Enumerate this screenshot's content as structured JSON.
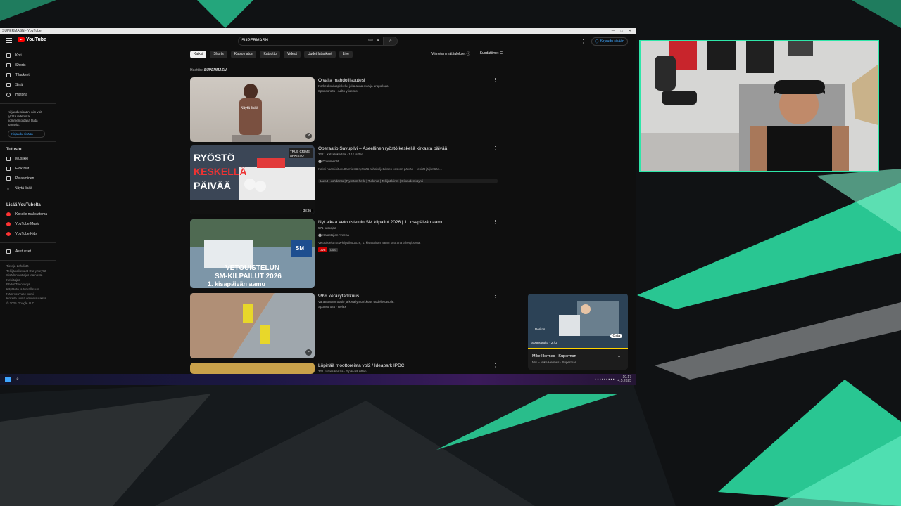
{
  "window": {
    "title": "SUPERMASN - YouTube",
    "controls": [
      "—",
      "□",
      "✕"
    ]
  },
  "header": {
    "logo_text": "YouTube",
    "logo_region": "FI",
    "search_value": "SUPERMASN",
    "search_kbd": "⌨",
    "clear_icon": "close-icon",
    "sign_in_label": "Kirjaudu sisään"
  },
  "sidebar": {
    "items": [
      {
        "label": "Koti",
        "icon": "home-icon"
      },
      {
        "label": "Shorts",
        "icon": "shorts-icon"
      },
      {
        "label": "Tilaukset",
        "icon": "subscriptions-icon"
      },
      {
        "label": "Sinä",
        "icon": "user-icon"
      },
      {
        "label": "Historia",
        "icon": "history-icon"
      }
    ],
    "signin_note": "Kirjaudu sisään, niin voit tykätä videoista, kommentoida ja tilata kanavia.",
    "signin_button": "Kirjaudu sisään",
    "explore_header": "Tutustu",
    "explore": [
      {
        "label": "Musiikki",
        "icon": "music-icon"
      },
      {
        "label": "Elokuvat",
        "icon": "film-icon"
      },
      {
        "label": "Pelaaminen",
        "icon": "gaming-icon"
      },
      {
        "label": "Näytä lisää",
        "icon": "chevron-down-icon"
      }
    ],
    "more_header": "Lisää YouTubelta",
    "more": [
      {
        "label": "Kokeile maksuttoma",
        "icon": "youtube-premium-icon"
      },
      {
        "label": "YouTube Music",
        "icon": "youtube-music-icon"
      },
      {
        "label": "YouTube Kids",
        "icon": "youtube-kids-icon"
      }
    ],
    "settings": "Asetukset",
    "footer_lines": [
      "Tietoja  Lehdistö",
      "Tekijänoikeudet  Ota yhteyttä",
      "Sisällöntuottajat  Mainosta",
      "Kehittäjät",
      "Ehdot  Tietosuoja",
      "Käytäntö ja turvallisuus",
      "Näin YouTube toimii",
      "Kokeile uusia ominaisuuksia",
      "© 2025 Google LLC"
    ]
  },
  "chips": [
    "Kaikki",
    "Shorts",
    "Katsomaton",
    "Katsottu",
    "Videot",
    "Uudet lataukset",
    "Live"
  ],
  "filters": {
    "left": "Viimeisimmät tulokset",
    "right": "Suodattimet"
  },
  "results_header": {
    "prefix": "Haettiin:",
    "query": "SUPERMASN"
  },
  "results": [
    {
      "title": "Oivalla mahdollisuutesi",
      "meta": "Sponsoroitu · Aalto-yliopisto",
      "desc": "Korkeakouluopiskelu, joka avaa ovia ja urapolkuja.",
      "duration": "",
      "overlay": "Näytä lisää"
    },
    {
      "title": "Operaatio Savupilvi – Aseellinen ryöstö keskellä kirkasta päivää",
      "meta": "222 t. katselukertaa · 10 t. sitten",
      "channel": "Dokumentit",
      "desc": "Kaksi naamioitunutta miestä ryöstää rahakuljetuksen kesken päivän – tekijät jäljitetään...",
      "duration": "38:36",
      "chapters": "Luvut | Johdanto | Ryöstön hetki | Tutkinta | Tekijät kiinni | Oikeudenkäynti"
    },
    {
      "title": "Nyt alkaa Vetouisteluin SM kilpailut 2026 | 1. kisapäivän aamu",
      "meta": "571 katsojaa",
      "channel": "Kalastajien Areena",
      "desc": "Vetouistelun SM-kilpailut 2026, 1. kisapäivän aamu suorana lähetyksenä.",
      "badge": "LIVE",
      "badge2": "Uusi"
    },
    {
      "title": "99% keräilytarkkuus",
      "meta": "Sponsoroitu · Relex",
      "desc": "Varastoautomaatio ja keräilyn tarkkuus uudelle tasolle.",
      "duration": ""
    },
    {
      "title": "Löpinää moottoreista vol2 / Ideapark IPDC",
      "meta": "321 katselukertaa · 2 päivää sitten",
      "desc": ""
    }
  ],
  "miniplayer": {
    "label": "Doritos",
    "ad": "Sponsoroitu · 2 / 2",
    "cta": "Osta",
    "title": "Mike Hermes · Superman",
    "sub": "Mix – Mike Hermes · Superman"
  },
  "taskbar": {
    "time": "10.17",
    "date": "4.5.2025"
  },
  "colors": {
    "accent": "#2ee6a8",
    "youtube_red": "#ff0000",
    "link_blue": "#3ea6ff"
  }
}
